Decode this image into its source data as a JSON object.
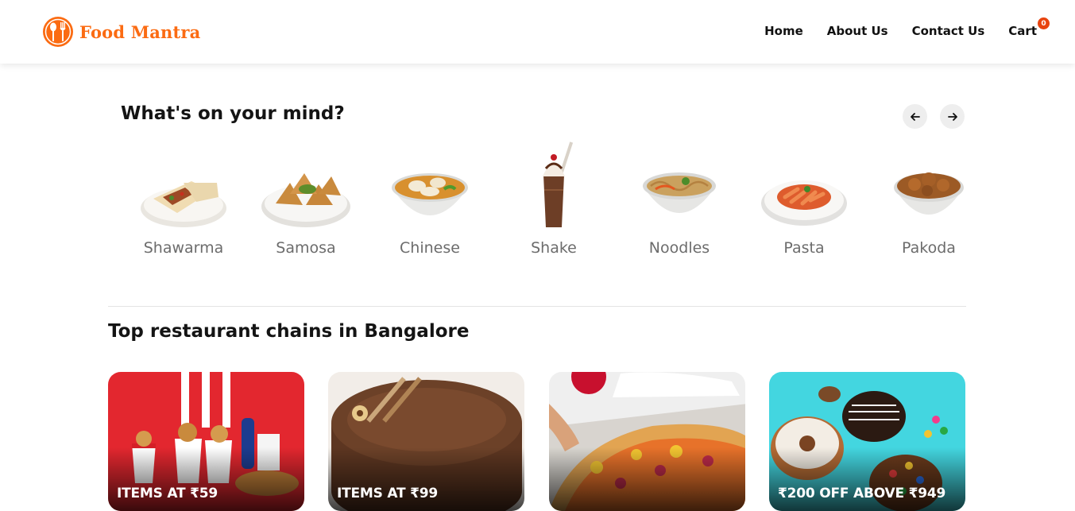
{
  "header": {
    "brand": "Food Mantra",
    "brand_color": "#fb6b12",
    "logo_icon": "fork-spoon-icon",
    "nav": [
      {
        "label": "Home"
      },
      {
        "label": "About Us"
      },
      {
        "label": "Contact Us"
      },
      {
        "label": "Cart"
      }
    ],
    "cart_count": "0"
  },
  "mind": {
    "title": "What's on your mind?",
    "prev_icon": "arrow-left-icon",
    "next_icon": "arrow-right-icon",
    "items": [
      {
        "label": "Shawarma"
      },
      {
        "label": "Samosa"
      },
      {
        "label": "Chinese"
      },
      {
        "label": "Shake"
      },
      {
        "label": "Noodles"
      },
      {
        "label": "Pasta"
      },
      {
        "label": "Pakoda"
      }
    ]
  },
  "chains": {
    "title": "Top restaurant chains in Bangalore",
    "cards": [
      {
        "offer": "ITEMS AT ₹59",
        "bg": "#e3272f"
      },
      {
        "offer": "ITEMS AT ₹99",
        "bg": "#f2ede8"
      },
      {
        "offer": "",
        "bg": "#efefef"
      },
      {
        "offer": "₹200 OFF ABOVE ₹949",
        "bg": "#43d6e0"
      }
    ]
  }
}
